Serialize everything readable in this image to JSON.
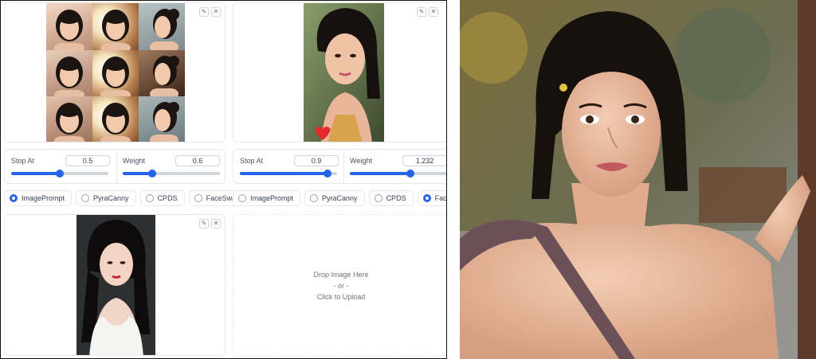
{
  "slots": [
    {
      "image_note": "",
      "stop_at": {
        "label": "Stop At",
        "value": "0.5",
        "fraction": 0.5
      },
      "weight": {
        "label": "Weight",
        "value": "0.6",
        "fraction": 0.3
      },
      "radio": {
        "options": [
          "ImagePrompt",
          "PyraCanny",
          "CPDS",
          "FaceSwap"
        ],
        "selected": "ImagePrompt"
      }
    },
    {
      "stop_at": {
        "label": "Stop At",
        "value": "0.9",
        "fraction": 0.9
      },
      "weight": {
        "label": "Weight",
        "value": "1.232",
        "fraction": 0.62
      },
      "radio": {
        "options": [
          "ImagePrompt",
          "PyraCanny",
          "CPDS",
          "FaceSwap"
        ],
        "selected": "FaceSwap"
      }
    }
  ],
  "drop_zone": {
    "line1": "Drop Image Here",
    "line2": "- or -",
    "line3": "Click to Upload"
  },
  "icons": {
    "edit": "pencil-icon",
    "clear": "close-icon"
  },
  "colors": {
    "accent": "#2563eb",
    "border": "#e5e7eb"
  }
}
